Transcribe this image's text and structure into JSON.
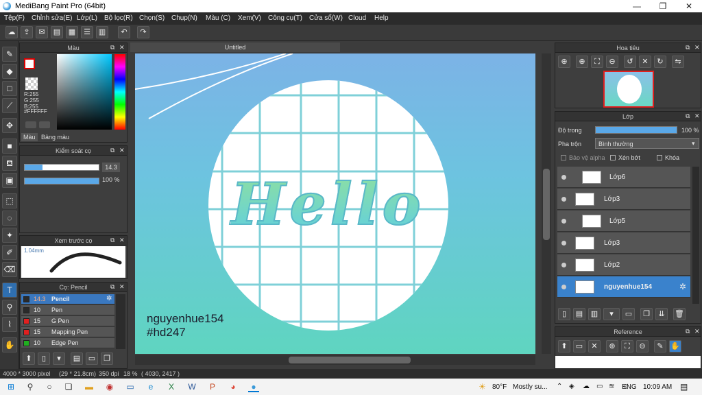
{
  "window": {
    "title": "MediBang Paint Pro (64bit)",
    "minimize": "—",
    "maximize": "❐",
    "close": "✕"
  },
  "menu": [
    "Tệp(F)",
    "Chỉnh sửa(E)",
    "Lớp(L)",
    "Bộ lọc(R)",
    "Chọn(S)",
    "Chụp(N)",
    "Màu (C)",
    "Xem(V)",
    "Công cụ(T)",
    "Cửa sổ(W)",
    "Cloud",
    "Help"
  ],
  "color_panel": {
    "title": "Màu",
    "r": "R:255",
    "g": "G:255",
    "b": "B:255",
    "hex": "#FFFFFF",
    "tab_color": "Màu",
    "tab_palette": "Bảng màu"
  },
  "brush_control": {
    "title": "Kiểm soát cọ",
    "size": "14.3",
    "opacity": "100 %",
    "size_fill": 0.24,
    "opacity_fill": 1.0
  },
  "preview": {
    "title": "Xem trước cọ",
    "size_label": "1.04mm"
  },
  "brush_list": {
    "title": "Cọ: Pencil",
    "items": [
      {
        "size": "14.3",
        "name": "Pencil",
        "color": "#2a2a2a"
      },
      {
        "size": "10",
        "name": "Pen",
        "color": "#2a2a2a"
      },
      {
        "size": "15",
        "name": "G Pen",
        "color": "#e02020"
      },
      {
        "size": "15",
        "name": "Mapping Pen",
        "color": "#e02020"
      },
      {
        "size": "10",
        "name": "Edge Pen",
        "color": "#20b020"
      }
    ]
  },
  "document": {
    "tab": "Untitled",
    "signature_line1": "nguyenhue154",
    "signature_line2": "#hd247",
    "artwork_text": "Hello"
  },
  "navigator": {
    "title": "Hoa tiêu"
  },
  "layers": {
    "title": "Lớp",
    "opacity_label": "Độ trong",
    "opacity_value": "100 %",
    "blend_label": "Pha trộn",
    "blend_value": "Bình thường",
    "protect_alpha": "Bảo vệ alpha",
    "clipping": "Xén bớt",
    "lock": "Khóa",
    "items": [
      "Lớp6",
      "Lớp3",
      "Lớp5",
      "Lớp3",
      "Lớp2",
      "nguyenhue154"
    ]
  },
  "reference": {
    "title": "Reference"
  },
  "status": {
    "dims": "4000 * 3000 pixel",
    "cm": "(29 * 21.8cm)",
    "dpi": "350 dpi",
    "zoom": "18 %",
    "coords": "( 4030, 2417 )"
  },
  "taskbar": {
    "weather": "80°F",
    "weather_desc": "Mostly su...",
    "lang": "ENG",
    "time": "10:09 AM"
  }
}
